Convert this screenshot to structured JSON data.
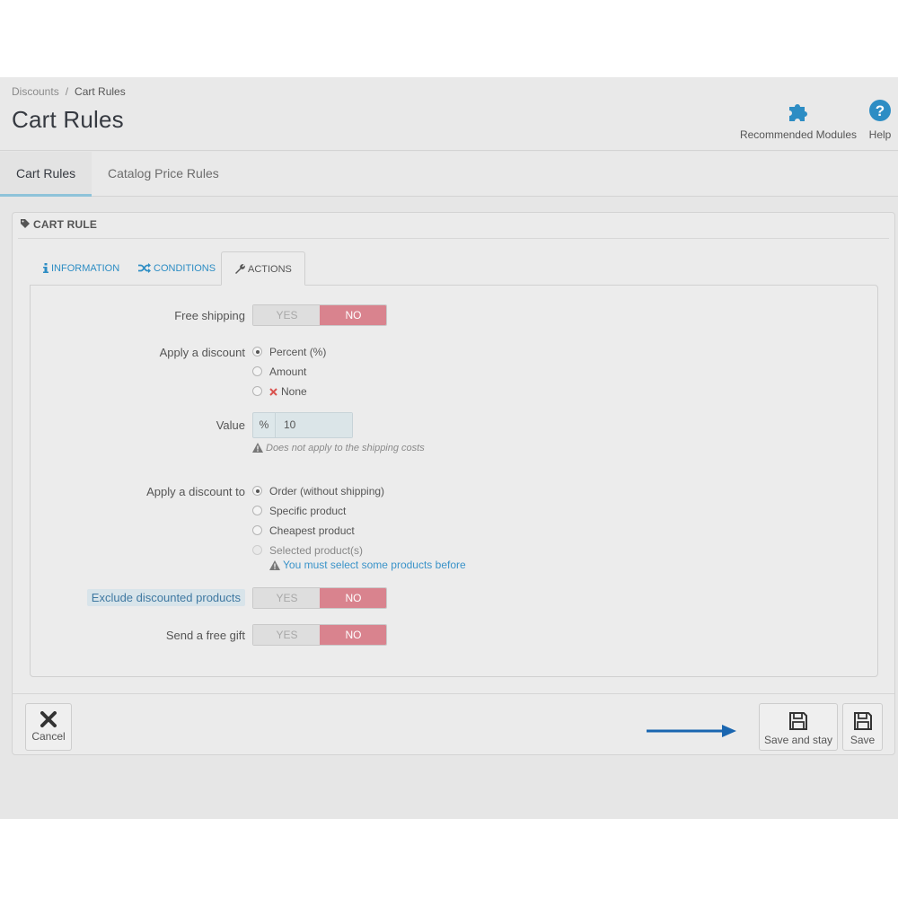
{
  "breadcrumb": {
    "parent": "Discounts",
    "separator": "/",
    "current": "Cart Rules"
  },
  "page_title": "Cart Rules",
  "toolbar": {
    "recommended_modules": "Recommended Modules",
    "help": "Help"
  },
  "top_tabs": [
    {
      "label": "Cart Rules",
      "active": true
    },
    {
      "label": "Catalog Price Rules",
      "active": false
    }
  ],
  "panel": {
    "heading": "CART RULE"
  },
  "sub_tabs": [
    {
      "label": "INFORMATION",
      "icon": "info-icon",
      "active": false
    },
    {
      "label": "CONDITIONS",
      "icon": "shuffle-icon",
      "active": false
    },
    {
      "label": "ACTIONS",
      "icon": "wrench-icon",
      "active": true
    }
  ],
  "form": {
    "free_shipping": {
      "label": "Free shipping",
      "yes": "YES",
      "no": "NO",
      "value": "NO"
    },
    "apply_discount": {
      "label": "Apply a discount",
      "options": [
        "Percent (%)",
        "Amount",
        "None"
      ],
      "selected": "Percent (%)"
    },
    "value": {
      "label": "Value",
      "addon": "%",
      "input": "10",
      "help": "Does not apply to the shipping costs"
    },
    "apply_discount_to": {
      "label": "Apply a discount to",
      "options": [
        "Order (without shipping)",
        "Specific product",
        "Cheapest product",
        "Selected product(s)"
      ],
      "selected": "Order (without shipping)",
      "help": "You must select some products before"
    },
    "exclude_discounted": {
      "label": "Exclude discounted products",
      "yes": "YES",
      "no": "NO",
      "value": "NO"
    },
    "free_gift": {
      "label": "Send a free gift",
      "yes": "YES",
      "no": "NO",
      "value": "NO"
    }
  },
  "footer": {
    "cancel": "Cancel",
    "save_and_stay": "Save and stay",
    "save": "Save"
  },
  "colors": {
    "accent_blue": "#2d8dc4",
    "switch_no": "#d9838e",
    "arrow": "#1a66b0"
  }
}
